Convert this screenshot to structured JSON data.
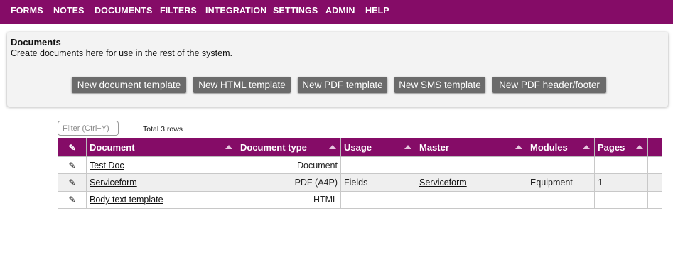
{
  "nav": {
    "items": [
      "FORMS",
      "NOTES",
      "DOCUMENTS",
      "FILTERS",
      "INTEGRATION",
      "SETTINGS",
      "ADMIN",
      "HELP"
    ]
  },
  "panel": {
    "title": "Documents",
    "description": "Create documents here for use in the rest of the system.",
    "buttons": [
      "New document template",
      "New HTML template",
      "New PDF template",
      "New SMS template",
      "New PDF header/footer"
    ]
  },
  "filter": {
    "placeholder": "Filter (Ctrl+Y)",
    "value": "",
    "total": "Total 3 rows"
  },
  "table": {
    "edit_icon": "pencil-icon",
    "columns": [
      "Document",
      "Document type",
      "Usage",
      "Master",
      "Modules",
      "Pages"
    ],
    "rows": [
      {
        "document": "Test Doc",
        "type": "Document",
        "usage": "",
        "master": "",
        "modules": "",
        "pages": ""
      },
      {
        "document": "Serviceform",
        "type": "PDF (A4P)",
        "usage": "Fields",
        "master": "Serviceform",
        "modules": "Equipment",
        "pages": "1"
      },
      {
        "document": "Body text template",
        "type": "HTML",
        "usage": "",
        "master": "",
        "modules": "",
        "pages": ""
      }
    ]
  },
  "colors": {
    "brand": "#850c67",
    "button": "#6b6b6b",
    "panel_bg": "#f3f3f3"
  }
}
